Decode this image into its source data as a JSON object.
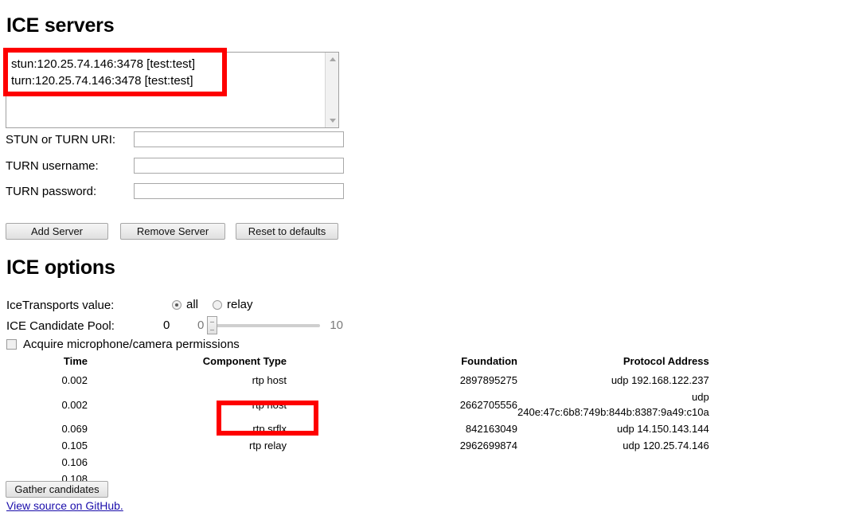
{
  "sections": {
    "servers_title": "ICE servers",
    "options_title": "ICE options"
  },
  "server_list": {
    "items": [
      "stun:120.25.74.146:3478 [test:test]",
      "turn:120.25.74.146:3478 [test:test]"
    ],
    "scrollbar": {
      "up_icon": "triangle-up-icon",
      "down_icon": "triangle-down-icon"
    }
  },
  "form": {
    "uri_label": "STUN or TURN URI:",
    "uri_value": "",
    "uri_placeholder": "",
    "username_label": "TURN username:",
    "username_value": "",
    "username_placeholder": "",
    "password_label": "TURN password:",
    "password_value": "",
    "password_placeholder": ""
  },
  "buttons": {
    "add_server": "Add Server",
    "remove_server": "Remove Server",
    "reset_defaults": "Reset to defaults",
    "gather_candidates": "Gather candidates"
  },
  "options": {
    "transports_label": "IceTransports value:",
    "transports_selected": "all",
    "radio_all": "all",
    "radio_relay": "relay",
    "pool_label": "ICE Candidate Pool:",
    "pool_value": "0",
    "pool_min": "0",
    "pool_max": "10",
    "permissions_label": "Acquire microphone/camera permissions",
    "permissions_checked": false
  },
  "candidates": {
    "headers": [
      "Time",
      "Component Type",
      "Foundation",
      "Protocol Address"
    ],
    "rows": [
      {
        "time": "0.002",
        "component": "rtp host",
        "foundation": "2897895275",
        "protocol": "udp 192.168.122.237"
      },
      {
        "time": "0.002",
        "component": "rtp host",
        "foundation": "2662705556",
        "protocol": "udp 240e:47c:6b8:749b:844b:8387:9a49:c10a"
      },
      {
        "time": "0.069",
        "component": "rtp srflx",
        "foundation": "842163049",
        "protocol": "udp 14.150.143.144"
      },
      {
        "time": "0.105",
        "component": "rtp relay",
        "foundation": "2962699874",
        "protocol": "udp 120.25.74.146"
      },
      {
        "time": "0.106",
        "component": "",
        "foundation": "",
        "protocol": ""
      },
      {
        "time": "0.108",
        "component": "",
        "foundation": "",
        "protocol": ""
      }
    ]
  },
  "footer": {
    "link_text": "View source on GitHub."
  },
  "annotations": {
    "color": "#fe0000",
    "boxes": [
      {
        "name": "server-list-highlight"
      },
      {
        "name": "component-type-highlight"
      }
    ]
  }
}
